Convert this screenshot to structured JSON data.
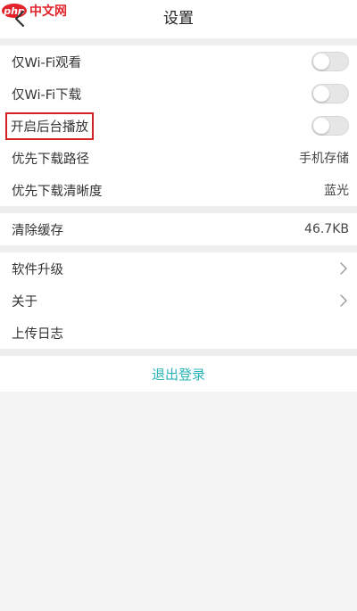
{
  "watermark": {
    "logo_text": "php",
    "site_text": "中文网"
  },
  "header": {
    "title": "设置",
    "back_icon": "chevron-left-icon"
  },
  "playback_group": {
    "wifi_only_watch": {
      "label": "仅Wi-Fi观看",
      "enabled": false
    },
    "wifi_only_download": {
      "label": "仅Wi-Fi下载",
      "enabled": false
    },
    "background_play": {
      "label": "开启后台播放",
      "enabled": false,
      "highlight_color": "#d42222"
    },
    "download_path": {
      "label": "优先下载路径",
      "value": "手机存储"
    },
    "download_quality": {
      "label": "优先下载清晰度",
      "value": "蓝光"
    }
  },
  "cache_group": {
    "clear_cache": {
      "label": "清除缓存",
      "value": "46.7KB"
    }
  },
  "misc_group": {
    "upgrade": {
      "label": "软件升级",
      "icon": "chevron-right-icon"
    },
    "about": {
      "label": "关于",
      "icon": "chevron-right-icon"
    },
    "upload_log": {
      "label": "上传日志"
    }
  },
  "logout": {
    "label": "退出登录",
    "color": "#2ab3b8"
  }
}
